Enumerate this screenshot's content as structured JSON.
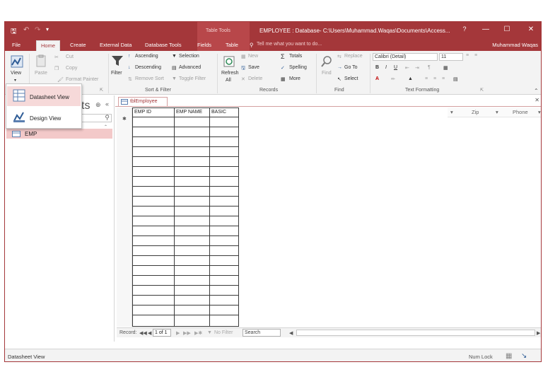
{
  "window": {
    "title": "EMPLOYEE : Database- C:\\Users\\Muhammad.Waqas\\Documents\\Access...",
    "context_label": "Table Tools",
    "help": "?",
    "minimize": "—",
    "maximize": "☐",
    "close": "✕"
  },
  "tabs": [
    {
      "label": "File"
    },
    {
      "label": "Home"
    },
    {
      "label": "Create"
    },
    {
      "label": "External Data"
    },
    {
      "label": "Database Tools"
    },
    {
      "label": "Fields"
    },
    {
      "label": "Table"
    }
  ],
  "tell_me": "Tell me what you want to do...",
  "user": "Muhammad Waqas",
  "ribbon": {
    "views": {
      "view": "View"
    },
    "clipboard": {
      "paste": "Paste",
      "cut": "Cut",
      "copy": "Copy",
      "format_painter": "Format Painter"
    },
    "sort_filter": {
      "label": "Sort & Filter",
      "filter": "Filter",
      "ascending": "Ascending",
      "descending": "Descending",
      "remove_sort": "Remove Sort",
      "selection": "Selection",
      "advanced": "Advanced",
      "toggle_filter": "Toggle Filter"
    },
    "records": {
      "label": "Records",
      "refresh": "Refresh",
      "refresh_all": "All",
      "new": "New",
      "save": "Save",
      "delete": "Delete",
      "totals": "Totals",
      "spelling": "Spelling",
      "more": "More"
    },
    "find": {
      "label": "Find",
      "find": "Find",
      "replace": "Replace",
      "go_to": "Go To",
      "select": "Select"
    },
    "text_formatting": {
      "label": "Text Formatting",
      "font": "Calibri (Detail)",
      "size": "11"
    }
  },
  "view_menu": [
    {
      "label": "Datasheet View"
    },
    {
      "label": "Design View"
    }
  ],
  "nav": {
    "title": "ts",
    "items": [
      {
        "label": "EMP"
      }
    ]
  },
  "document": {
    "tab": "tblEmployee",
    "columns": [
      "EMP ID",
      "EMP NAME",
      "BASIC"
    ],
    "faint_columns": [
      "Zip",
      "Phone"
    ]
  },
  "record_nav": {
    "label": "Record:",
    "current": "1 of 1",
    "no_filter": "No Filter",
    "search": "Search"
  },
  "status": {
    "left": "Datasheet View",
    "numlock": "Num Lock"
  },
  "colors": {
    "accent": "#a4373a",
    "ribbon": "#f3f3f3",
    "selected": "#f3c9c9"
  }
}
